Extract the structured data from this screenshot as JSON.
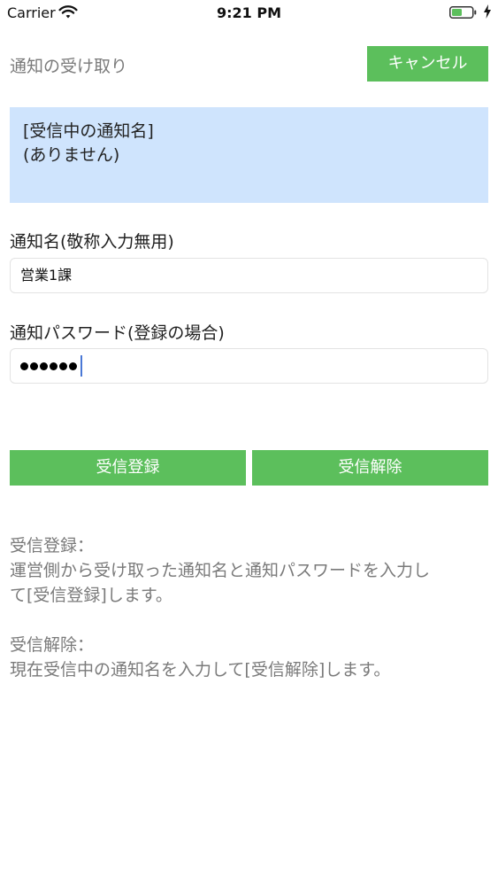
{
  "status_bar": {
    "carrier": "Carrier",
    "time": "9:21 PM",
    "icons": [
      "wifi-icon",
      "battery-icon",
      "charging-bolt-icon"
    ]
  },
  "header": {
    "title": "通知の受け取り",
    "cancel_label": "キャンセル"
  },
  "info_panel": {
    "line1": "[受信中の通知名]",
    "line2": "(ありません)"
  },
  "form": {
    "name_label": "通知名(敬称入力無用)",
    "name_value": "営業1課",
    "password_label": "通知パスワード(登録の場合)",
    "password_masked_count": 6
  },
  "actions": {
    "register_label": "受信登録",
    "unregister_label": "受信解除"
  },
  "help": {
    "register_title": "受信登録：",
    "register_line1": "運営側から受け取った通知名と通知パスワードを入力し",
    "register_line2": "て[受信登録]します。",
    "unregister_title": "受信解除：",
    "unregister_line1": "現在受信中の通知名を入力して[受信解除]します。"
  },
  "colors": {
    "accent_green": "#5cbf5c",
    "info_panel_bg": "#cfe4fd",
    "muted_text": "#7a7a7a"
  }
}
